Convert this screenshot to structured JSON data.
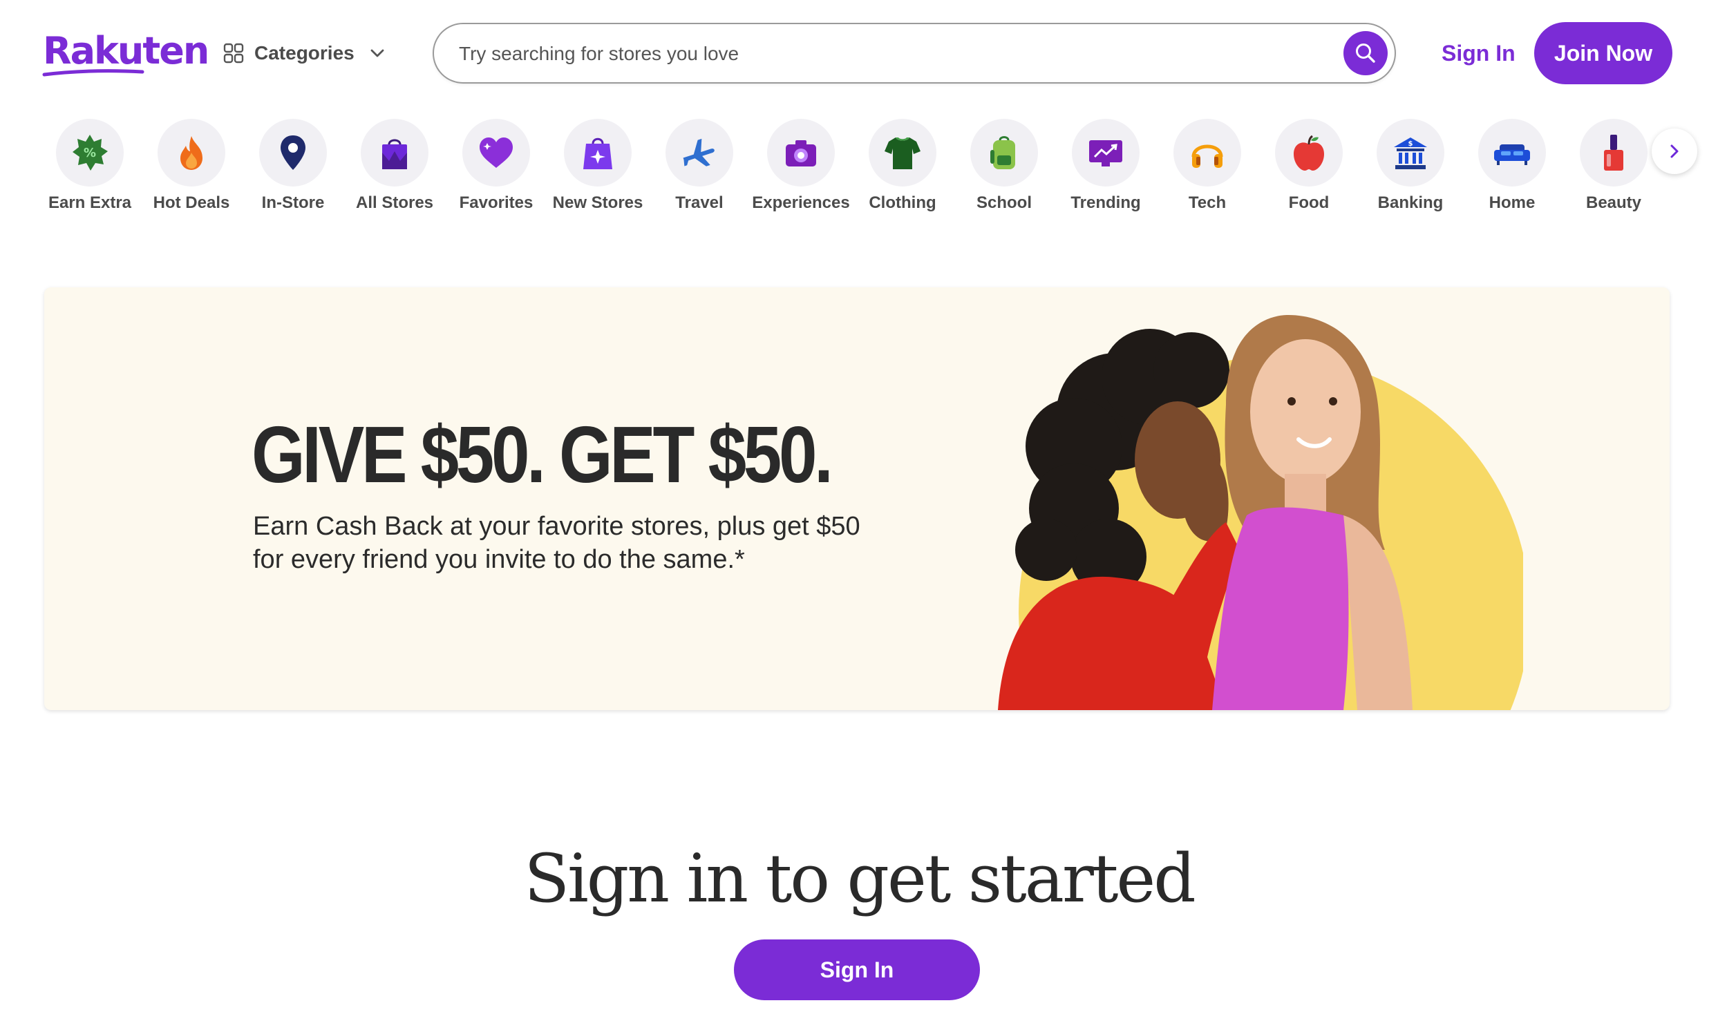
{
  "header": {
    "logo_text": "Rakuten",
    "categories_label": "Categories",
    "search": {
      "placeholder": "Try searching for stores you love",
      "value": ""
    },
    "sign_in_label": "Sign In",
    "join_label": "Join Now"
  },
  "categories": [
    {
      "label": "Earn Extra",
      "icon": "badge-percent-icon"
    },
    {
      "label": "Hot Deals",
      "icon": "flame-icon"
    },
    {
      "label": "In-Store",
      "icon": "map-pin-icon"
    },
    {
      "label": "All Stores",
      "icon": "shopping-bag-icon"
    },
    {
      "label": "Favorites",
      "icon": "heart-icon"
    },
    {
      "label": "New Stores",
      "icon": "sparkle-bag-icon"
    },
    {
      "label": "Travel",
      "icon": "airplane-icon"
    },
    {
      "label": "Experiences",
      "icon": "camera-icon"
    },
    {
      "label": "Clothing",
      "icon": "tshirt-icon"
    },
    {
      "label": "School",
      "icon": "backpack-icon"
    },
    {
      "label": "Trending",
      "icon": "trending-chart-icon"
    },
    {
      "label": "Tech",
      "icon": "headphones-icon"
    },
    {
      "label": "Food",
      "icon": "apple-icon"
    },
    {
      "label": "Banking",
      "icon": "bank-icon"
    },
    {
      "label": "Home",
      "icon": "sofa-icon"
    },
    {
      "label": "Beauty",
      "icon": "nail-polish-icon"
    }
  ],
  "hero": {
    "headline": "GIVE $50. GET $50.",
    "subtext": "Earn Cash Back at your favorite stores, plus get $50 for every friend you invite to do the same.*"
  },
  "signin_section": {
    "heading": "Sign in to get started",
    "button_label": "Sign In"
  },
  "colors": {
    "brand_purple": "#7b2cd6",
    "hero_bg": "#fdf9ee",
    "hero_circle": "#f7d966"
  }
}
